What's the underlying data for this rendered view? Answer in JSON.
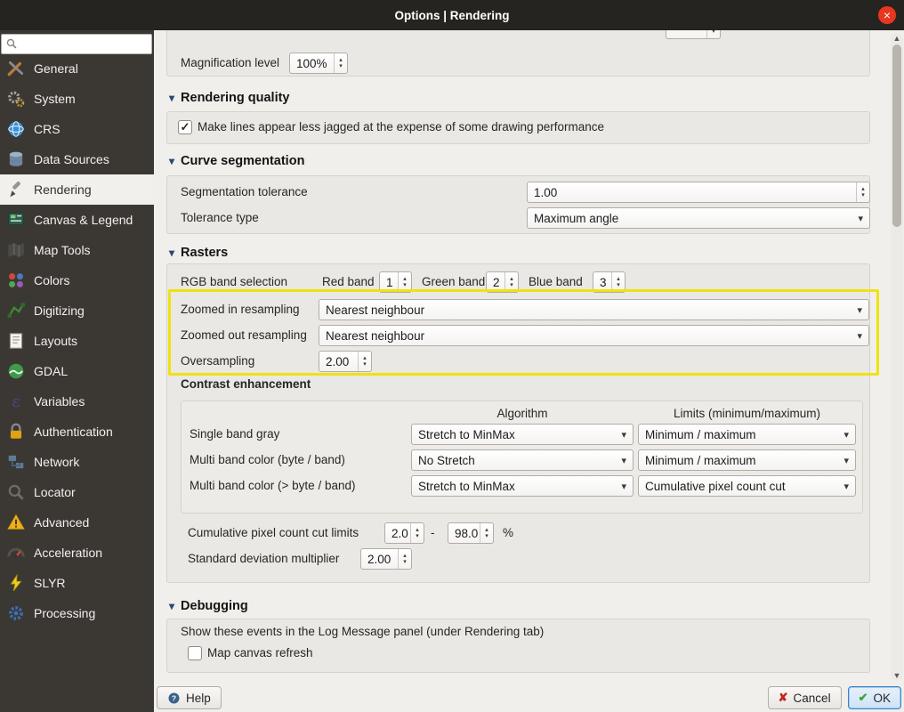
{
  "window": {
    "title": "Options | Rendering",
    "close_icon": "×"
  },
  "icons": {
    "caret": "▾",
    "spin_up": "▴",
    "spin_down": "▾",
    "check": "✓",
    "scroll_up": "▲",
    "scroll_down": "▼",
    "cancel": "✘",
    "ok": "✔",
    "help": "?"
  },
  "sidebar": {
    "items": [
      {
        "label": "General",
        "icon": "tools-icon"
      },
      {
        "label": "System",
        "icon": "gears-icon"
      },
      {
        "label": "CRS",
        "icon": "globe-icon"
      },
      {
        "label": "Data Sources",
        "icon": "database-icon"
      },
      {
        "label": "Rendering",
        "icon": "paintbrush-icon"
      },
      {
        "label": "Canvas & Legend",
        "icon": "canvas-legend-icon"
      },
      {
        "label": "Map Tools",
        "icon": "map-icon"
      },
      {
        "label": "Colors",
        "icon": "color-swatches-icon"
      },
      {
        "label": "Digitizing",
        "icon": "digitizing-icon"
      },
      {
        "label": "Layouts",
        "icon": "page-icon"
      },
      {
        "label": "GDAL",
        "icon": "gdal-icon"
      },
      {
        "label": "Variables",
        "icon": "variables-icon"
      },
      {
        "label": "Authentication",
        "icon": "lock-icon"
      },
      {
        "label": "Network",
        "icon": "network-icon"
      },
      {
        "label": "Locator",
        "icon": "magnifier-icon"
      },
      {
        "label": "Advanced",
        "icon": "warning-icon"
      },
      {
        "label": "Acceleration",
        "icon": "gauge-icon"
      },
      {
        "label": "SLYR",
        "icon": "bolt-icon"
      },
      {
        "label": "Processing",
        "icon": "processing-gear-icon"
      }
    ]
  },
  "content": {
    "magnification": {
      "label": "Magnification level",
      "value": "100%"
    },
    "rendering_quality": {
      "title": "Rendering quality",
      "antialias_label": "Make lines appear less jagged at the expense of some drawing performance"
    },
    "curve": {
      "title": "Curve segmentation",
      "tolerance_label": "Segmentation tolerance",
      "tolerance_value": "1.00",
      "type_label": "Tolerance type",
      "type_value": "Maximum angle"
    },
    "rasters": {
      "title": "Rasters",
      "rgb_label": "RGB band selection",
      "red_label": "Red band",
      "red_value": "1",
      "green_label": "Green band",
      "green_value": "2",
      "blue_label": "Blue band",
      "blue_value": "3",
      "zoom_in_label": "Zoomed in resampling",
      "zoom_in_value": "Nearest neighbour",
      "zoom_out_label": "Zoomed out resampling",
      "zoom_out_value": "Nearest neighbour",
      "oversampling_label": "Oversampling",
      "oversampling_value": "2.00"
    },
    "contrast": {
      "title": "Contrast enhancement",
      "col_algorithm": "Algorithm",
      "col_limits": "Limits (minimum/maximum)",
      "rows": [
        {
          "label": "Single band gray",
          "algorithm": "Stretch to MinMax",
          "limits": "Minimum / maximum"
        },
        {
          "label": "Multi band color (byte / band)",
          "algorithm": "No Stretch",
          "limits": "Minimum / maximum"
        },
        {
          "label": "Multi band color (> byte / band)",
          "algorithm": "Stretch to MinMax",
          "limits": "Cumulative pixel count cut"
        }
      ],
      "cum_label": "Cumulative pixel count cut limits",
      "cum_min": "2.0",
      "cum_dash": "-",
      "cum_max": "98.0",
      "cum_unit": "%",
      "std_label": "Standard deviation multiplier",
      "std_value": "2.00"
    },
    "debugging": {
      "title": "Debugging",
      "info": "Show these events in the Log Message panel (under Rendering tab)",
      "cb_label": "Map canvas refresh"
    }
  },
  "footer": {
    "help": "Help",
    "cancel": "Cancel",
    "ok": "OK"
  }
}
